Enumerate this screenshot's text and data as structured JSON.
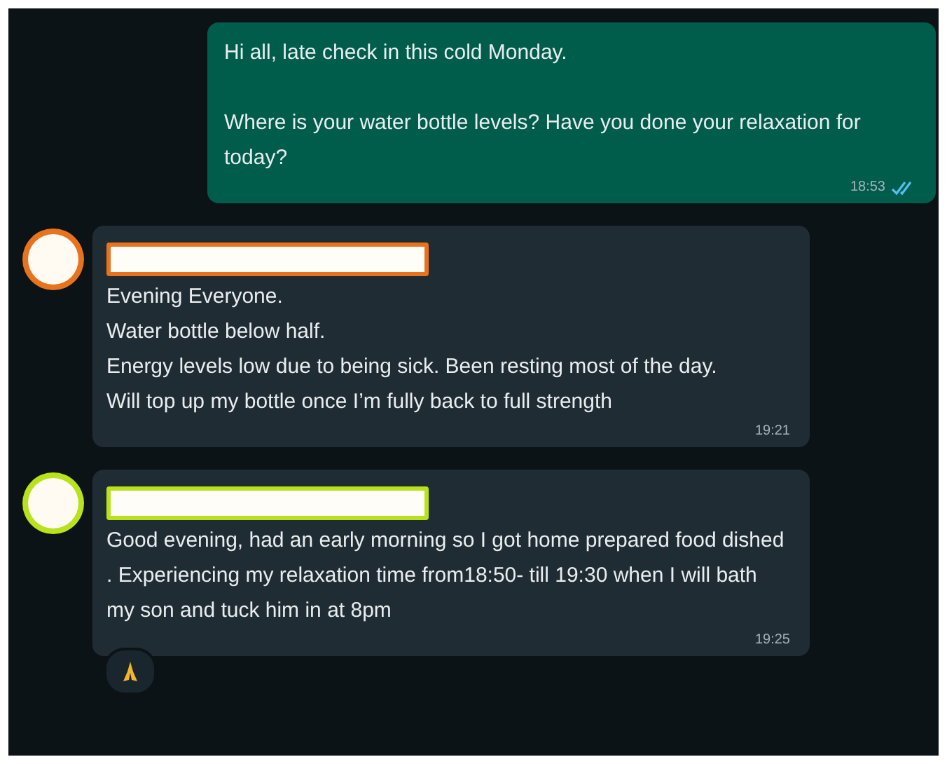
{
  "messages": [
    {
      "kind": "outgoing",
      "paragraphs": [
        "Hi all, late check in this cold Monday.",
        "Where is your water bottle levels? Have you done your relaxation for today?"
      ],
      "time": "18:53",
      "read": true
    },
    {
      "kind": "incoming",
      "color": "#e8731e",
      "paragraphs": [
        "Evening Everyone.",
        "Water bottle below half.",
        "Energy levels low due to being sick. Been resting most of the day.",
        "Will top up my bottle once I’m fully back to full strength"
      ],
      "time": "19:21"
    },
    {
      "kind": "incoming",
      "color": "#b8e21c",
      "paragraphs": [
        "Good evening, had an early morning so I got home prepared food dished . Experiencing my relaxation time from18:50- till 19:30 when I will bath my son and tuck him in at 8pm"
      ],
      "time": "19:25",
      "reaction": true
    }
  ]
}
